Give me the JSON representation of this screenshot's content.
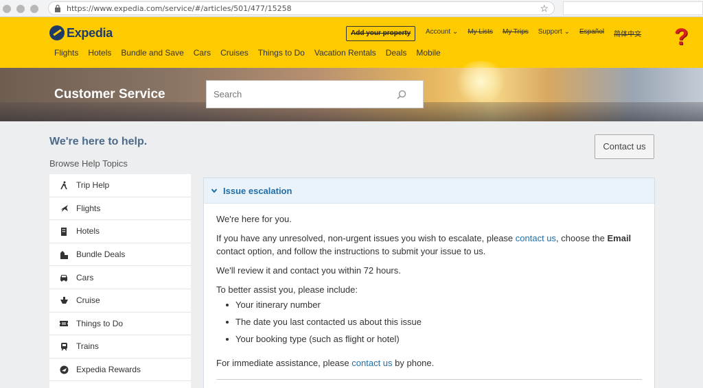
{
  "browser": {
    "url": "https://www.expedia.com/service/#/articles/501/477/15258"
  },
  "header": {
    "logo_text": "Expedia",
    "add_property": "Add your property",
    "top_nav": [
      "Account",
      "My Lists",
      "My Trips",
      "Support",
      "Español",
      "简体中文"
    ],
    "help_glyph": "?",
    "main_nav": [
      "Flights",
      "Hotels",
      "Bundle and Save",
      "Cars",
      "Cruises",
      "Things to Do",
      "Vacation Rentals",
      "Deals",
      "Mobile"
    ]
  },
  "banner": {
    "title": "Customer Service",
    "search_placeholder": "Search"
  },
  "content": {
    "heading": "We're here to help.",
    "browse_label": "Browse Help Topics",
    "contact_button": "Contact us"
  },
  "sidebar": {
    "items": [
      {
        "label": "Trip Help",
        "icon": "trip-help-icon"
      },
      {
        "label": "Flights",
        "icon": "plane-icon"
      },
      {
        "label": "Hotels",
        "icon": "hotel-icon"
      },
      {
        "label": "Bundle Deals",
        "icon": "bundle-icon"
      },
      {
        "label": "Cars",
        "icon": "car-icon"
      },
      {
        "label": "Cruise",
        "icon": "cruise-icon"
      },
      {
        "label": "Things to Do",
        "icon": "ticket-icon"
      },
      {
        "label": "Trains",
        "icon": "train-icon"
      },
      {
        "label": "Expedia Rewards",
        "icon": "rewards-icon"
      }
    ]
  },
  "article": {
    "title": "Issue escalation",
    "p1": "We're here for you.",
    "p2_a": "If you have any unresolved, non-urgent issues you wish to escalate, please ",
    "p2_link": "contact us",
    "p2_b": ", choose the ",
    "p2_bold": "Email",
    "p2_c": " contact option, and follow the instructions to submit your issue to us.",
    "p3": "We'll review it and contact you within 72 hours.",
    "p4": "To better assist you, please include:",
    "bullets": [
      "Your itinerary number",
      "The date you last contacted us about this issue",
      "Your booking type (such as flight or hotel)"
    ],
    "p5_a": "For immediate assistance, please ",
    "p5_link": "contact us",
    "p5_b": " by phone."
  },
  "colors": {
    "header_yellow": "#fecb00",
    "brand_navy": "#1f3a67",
    "link_blue": "#1f6ea8"
  }
}
